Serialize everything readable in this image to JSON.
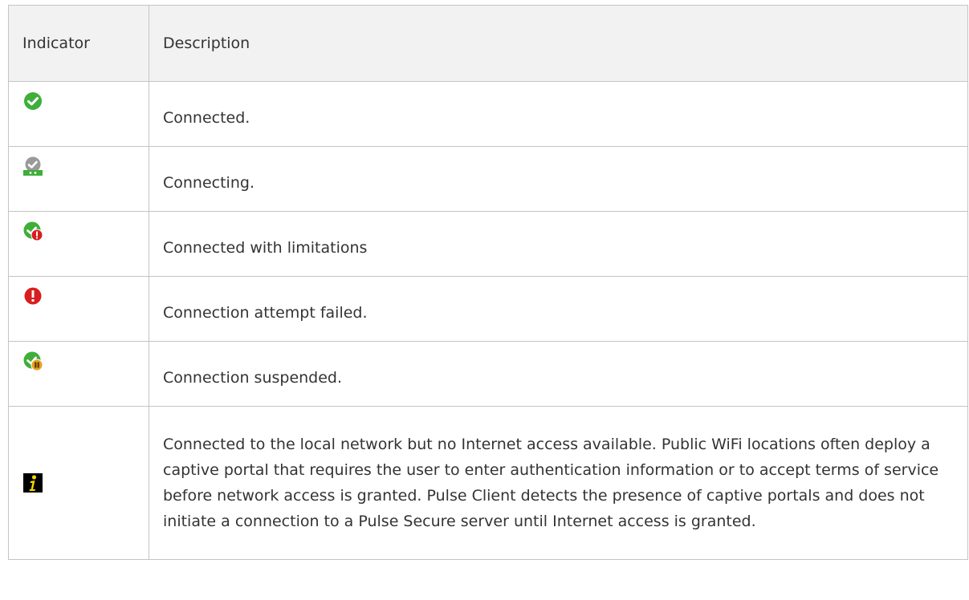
{
  "header": {
    "indicator_label": "Indicator",
    "description_label": "Description"
  },
  "rows": [
    {
      "icon": "connected-check-icon",
      "description": "Connected."
    },
    {
      "icon": "connecting-icon",
      "description": "Connecting."
    },
    {
      "icon": "connected-limited-icon",
      "description": "Connected with limitations"
    },
    {
      "icon": "failed-icon",
      "description": "Connection attempt failed."
    },
    {
      "icon": "suspended-icon",
      "description": "Connection suspended."
    },
    {
      "icon": "info-icon",
      "description": "Connected to the local network but no Internet access available. Public WiFi locations often deploy a captive portal that requires the user to enter authentication information or to accept terms of service before network access is granted. Pulse Client detects the presence of captive portals and does not initiate a connection to a Pulse Secure server until Internet access is granted."
    }
  ],
  "colors": {
    "green": "#3fae3a",
    "gray": "#9a9a9a",
    "red": "#d81e1e",
    "orange": "#e8a020",
    "info_bg": "#000000",
    "info_fg": "#f5d800",
    "border": "#c4c4c4",
    "header_bg": "#f2f2f2"
  }
}
